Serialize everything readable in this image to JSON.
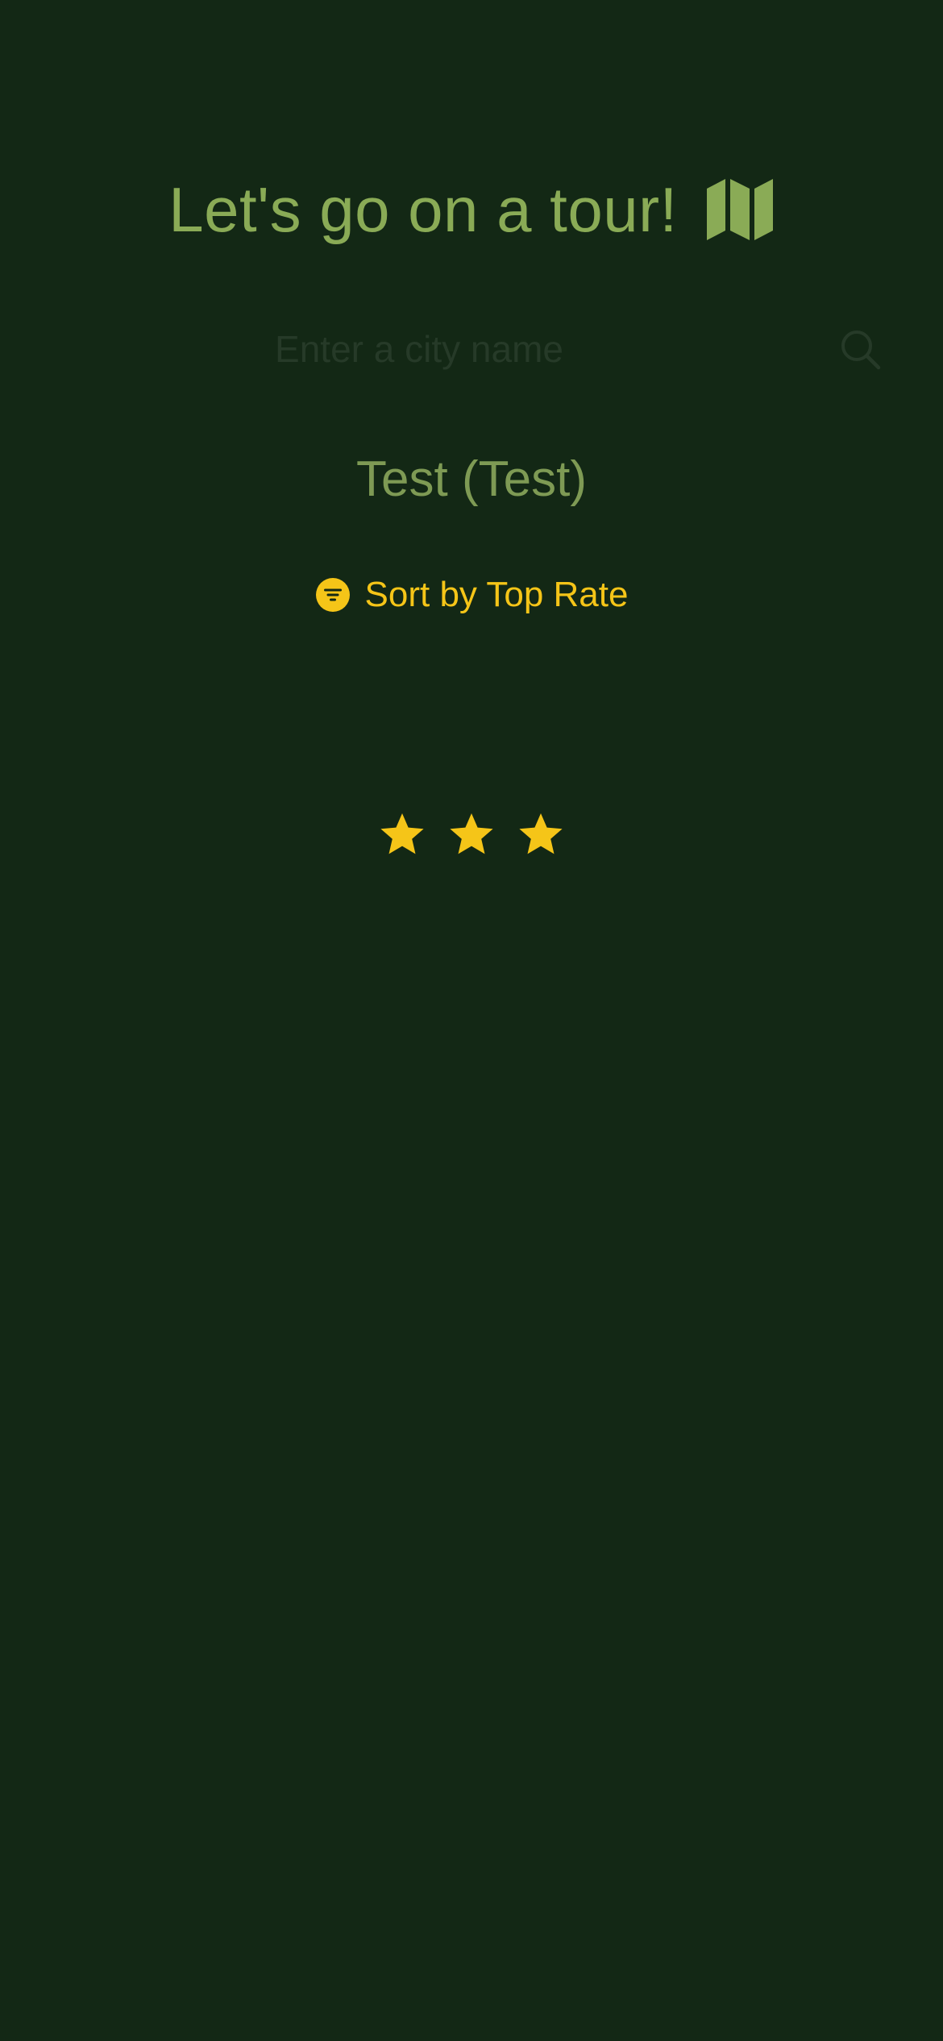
{
  "header": {
    "title": "Let's go on a tour!",
    "icon": "map-icon"
  },
  "search": {
    "placeholder": "Enter a city name",
    "value": "",
    "icon": "search-icon"
  },
  "city": {
    "label": "Test (Test)"
  },
  "sort": {
    "label": "Sort by Top Rate",
    "icon": "filter-icon"
  },
  "rating": {
    "stars": 3,
    "max": 3,
    "icon": "star-icon"
  },
  "colors": {
    "background": "#132815",
    "accent_green": "#8aab56",
    "accent_yellow": "#f5c518",
    "muted": "#263a28"
  }
}
